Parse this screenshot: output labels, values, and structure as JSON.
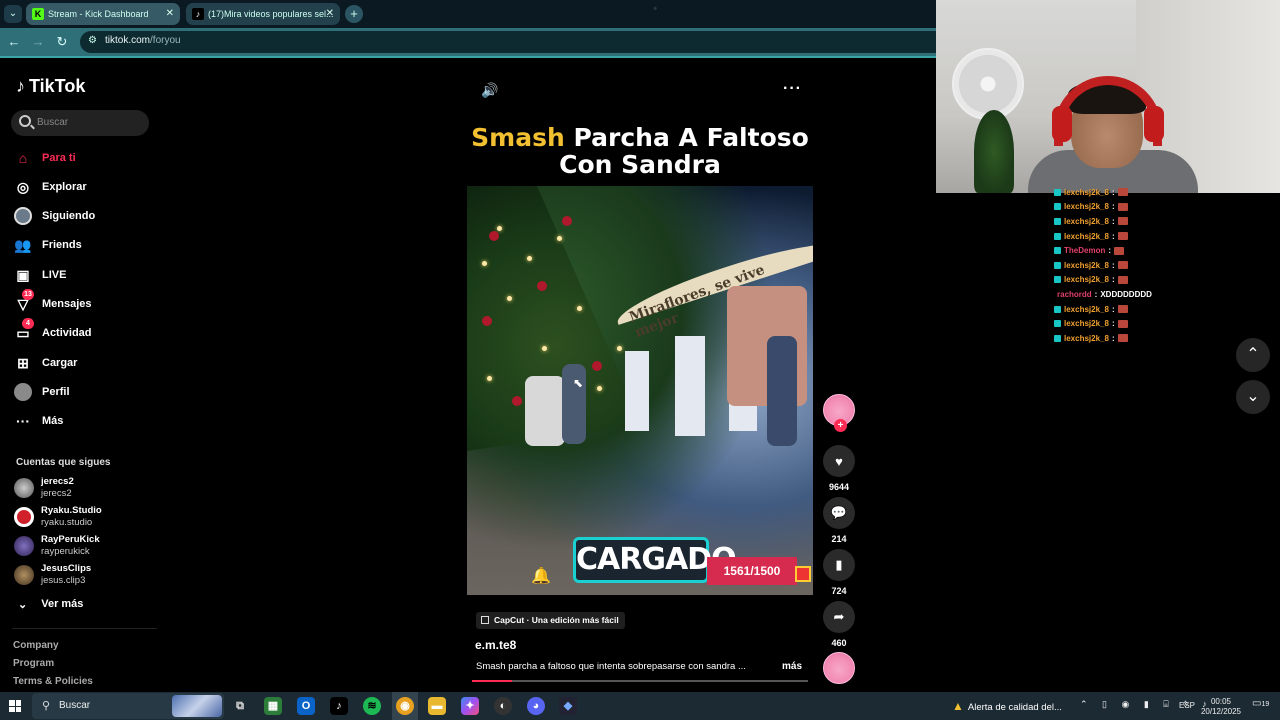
{
  "browser": {
    "tabs": [
      {
        "title": "Stream - Kick Dashboard",
        "icon": "K"
      },
      {
        "title": "(17)Mira videos populares sel...",
        "icon": "♪"
      }
    ],
    "url_host": "tiktok.com",
    "url_path": "/foryou"
  },
  "sidebar": {
    "logo": "TikTok",
    "search_placeholder": "Buscar",
    "nav": [
      {
        "label": "Para ti",
        "icon": "home-icon",
        "active": true
      },
      {
        "label": "Explorar",
        "icon": "compass-icon"
      },
      {
        "label": "Siguiendo",
        "icon": "avatar-icon"
      },
      {
        "label": "Friends",
        "icon": "friends-icon"
      },
      {
        "label": "LIVE",
        "icon": "live-icon"
      },
      {
        "label": "Mensajes",
        "icon": "send-icon",
        "badge": "13"
      },
      {
        "label": "Actividad",
        "icon": "activity-icon",
        "badge": "4"
      },
      {
        "label": "Cargar",
        "icon": "upload-icon"
      },
      {
        "label": "Perfil",
        "icon": "profile-icon"
      },
      {
        "label": "Más",
        "icon": "more-icon"
      }
    ],
    "following_title": "Cuentas que sigues",
    "following": [
      {
        "name": "jerecs2",
        "handle": "jerecs2"
      },
      {
        "name": "Ryaku.Studio",
        "handle": "ryaku.studio"
      },
      {
        "name": "RayPeruKick",
        "handle": "rayperukick"
      },
      {
        "name": "JesusClips",
        "handle": "jesus.clip3"
      }
    ],
    "see_more": "Ver más",
    "footer": [
      "Company",
      "Program",
      "Terms & Policies"
    ]
  },
  "video": {
    "title_highlight": "Smash",
    "title_line1_rest": " Parcha A Faltoso",
    "title_line2": "Con Sandra",
    "arch_text": "Miraflores, se vive mejor",
    "overlay_label": "CARGADO",
    "overlay_count": "1561/1500",
    "capcut_label": "CapCut · Una edición más fácil",
    "author": "e.m.te8",
    "description": "Smash parcha a faltoso que intenta sobrepasarse con sandra ...",
    "more_label": "más",
    "progress": 0.12
  },
  "actions": {
    "likes": "9644",
    "comments": "214",
    "saves": "724",
    "shares": "460"
  },
  "chat": [
    {
      "user": "lexchsj2k_8",
      "color": "#f0a030",
      "msg": ""
    },
    {
      "user": "lexchsj2k_8",
      "color": "#f0a030",
      "msg": ""
    },
    {
      "user": "lexchsj2k_8",
      "color": "#f0a030",
      "msg": ""
    },
    {
      "user": "lexchsj2k_8",
      "color": "#f0a030",
      "msg": ""
    },
    {
      "user": "TheDemon",
      "color": "#e0406a",
      "msg": ""
    },
    {
      "user": "lexchsj2k_8",
      "color": "#f0a030",
      "msg": ""
    },
    {
      "user": "lexchsj2k_8",
      "color": "#f0a030",
      "msg": ""
    },
    {
      "user": "rachordd",
      "color": "#e0406a",
      "msg": "XDDDDDDDD",
      "no_badge": true
    },
    {
      "user": "lexchsj2k_8",
      "color": "#f0a030",
      "msg": ""
    },
    {
      "user": "lexchsj2k_8",
      "color": "#f0a030",
      "msg": ""
    },
    {
      "user": "lexchsj2k_8",
      "color": "#f0a030",
      "msg": ""
    }
  ],
  "taskbar": {
    "search": "Buscar",
    "alert": "Alerta de calidad del...",
    "lang": "ESP",
    "time": "00:05",
    "date": "20/12/2025",
    "notif_count": "19"
  }
}
